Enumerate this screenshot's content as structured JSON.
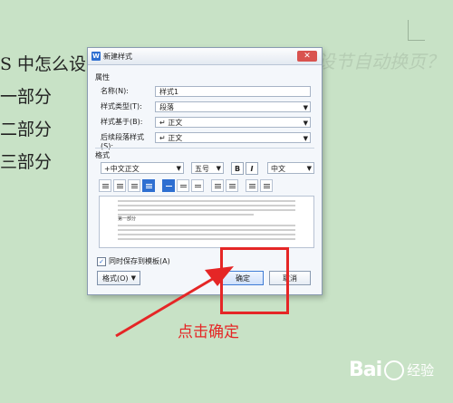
{
  "document": {
    "line1": "S 中怎么设",
    "line1_faded": "设节自动换页？",
    "line2": "一部分",
    "line3": "二部分",
    "line4": "三部分"
  },
  "dialog": {
    "app_icon": "W",
    "title": "新建样式",
    "close_symbol": "✕",
    "properties_section": "属性",
    "fields": {
      "name_label": "名称(N):",
      "name_value": "样式1",
      "style_type_label": "样式类型(T):",
      "style_type_value": "段落",
      "based_on_label": "样式基于(B):",
      "based_on_value": "↵ 正文",
      "next_style_label": "后续段落样式(S):",
      "next_style_value": "↵ 正文"
    },
    "format_section": "格式",
    "font_value": "+中文正文",
    "size_value": "五号",
    "bold_label": "B",
    "italic_label": "I",
    "language_value": "中文",
    "preview_bold_text": "第一部分",
    "add_to_template_label": "同时保存到模板(A)",
    "format_button_label": "格式(O)",
    "ok_button_label": "确定",
    "cancel_button_label": "取消"
  },
  "annotation": {
    "text": "点击确定",
    "color": "#e52626"
  },
  "watermark": {
    "brand": "Bai",
    "sub": "经验"
  }
}
